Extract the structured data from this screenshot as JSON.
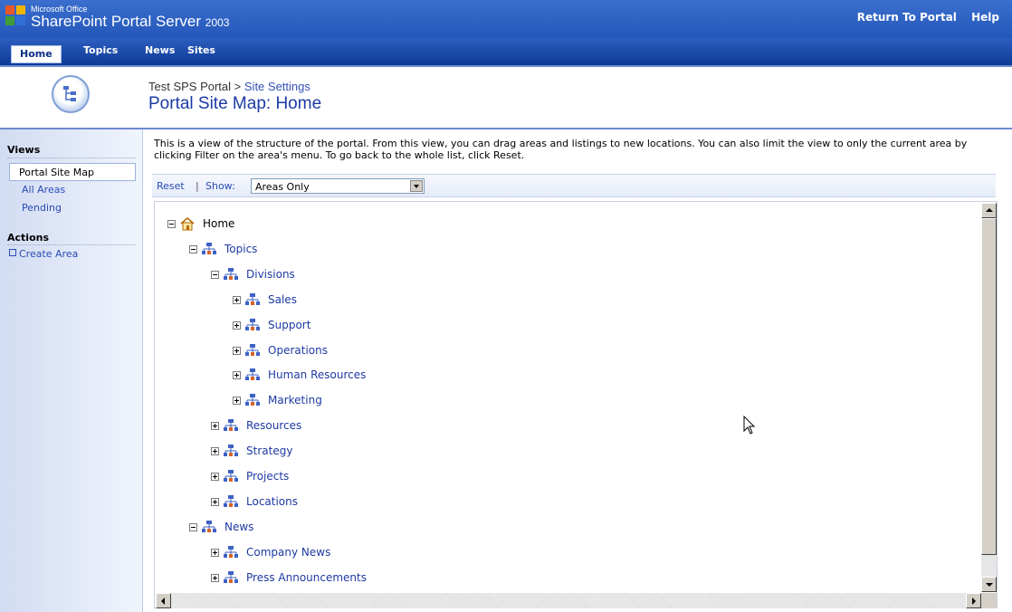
{
  "header": {
    "brand_small": "Microsoft Office",
    "brand_main": "SharePoint Portal Server",
    "brand_year": "2003",
    "links": [
      "Return To Portal",
      "Help"
    ]
  },
  "nav": {
    "tabs": [
      "Home",
      "Topics",
      "News",
      "Sites"
    ],
    "active": "Home"
  },
  "breadcrumb": {
    "root": "Test SPS Portal",
    "separator": ">",
    "current": "Site Settings"
  },
  "page_title": "Portal Site Map: Home",
  "left_nav": {
    "views_heading": "Views",
    "views": [
      "Portal Site Map",
      "All Areas",
      "Pending"
    ],
    "selected_view": "Portal Site Map",
    "actions_heading": "Actions",
    "actions": [
      "Create Area"
    ]
  },
  "description": "This is a view of the structure of the portal. From this view, you can drag areas and listings to new locations. You can also limit the view to only the current area by clicking Filter on the area's menu. To go back to the whole list, click Reset.",
  "filter": {
    "reset_label": "Reset",
    "separator": "|",
    "show_label": "Show:",
    "show_value": "Areas Only"
  },
  "tree": [
    {
      "label": "Home",
      "icon": "home-icon",
      "expanded": true,
      "level": 0
    },
    {
      "label": "Topics",
      "icon": "area-icon",
      "expanded": true,
      "level": 1
    },
    {
      "label": "Divisions",
      "icon": "area-icon",
      "expanded": true,
      "level": 2
    },
    {
      "label": "Sales",
      "icon": "area-icon",
      "expanded": false,
      "level": 3
    },
    {
      "label": "Support",
      "icon": "area-icon",
      "expanded": false,
      "level": 3
    },
    {
      "label": "Operations",
      "icon": "area-icon",
      "expanded": false,
      "level": 3
    },
    {
      "label": "Human Resources",
      "icon": "area-icon",
      "expanded": false,
      "level": 3
    },
    {
      "label": "Marketing",
      "icon": "area-icon",
      "expanded": false,
      "level": 3
    },
    {
      "label": "Resources",
      "icon": "area-icon",
      "expanded": false,
      "level": 2
    },
    {
      "label": "Strategy",
      "icon": "area-icon",
      "expanded": false,
      "level": 2
    },
    {
      "label": "Projects",
      "icon": "area-icon",
      "expanded": false,
      "level": 2
    },
    {
      "label": "Locations",
      "icon": "area-icon",
      "expanded": false,
      "level": 2
    },
    {
      "label": "News",
      "icon": "area-icon",
      "expanded": true,
      "level": 1
    },
    {
      "label": "Company News",
      "icon": "area-icon",
      "expanded": false,
      "level": 2
    },
    {
      "label": "Press Announcements",
      "icon": "area-icon",
      "expanded": false,
      "level": 2
    }
  ],
  "colors": {
    "header_blue": "#2457b9",
    "link_blue": "#1f3aa3",
    "title_blue": "#1b3aa6",
    "left_nav_bg": "#d2dcf2"
  }
}
